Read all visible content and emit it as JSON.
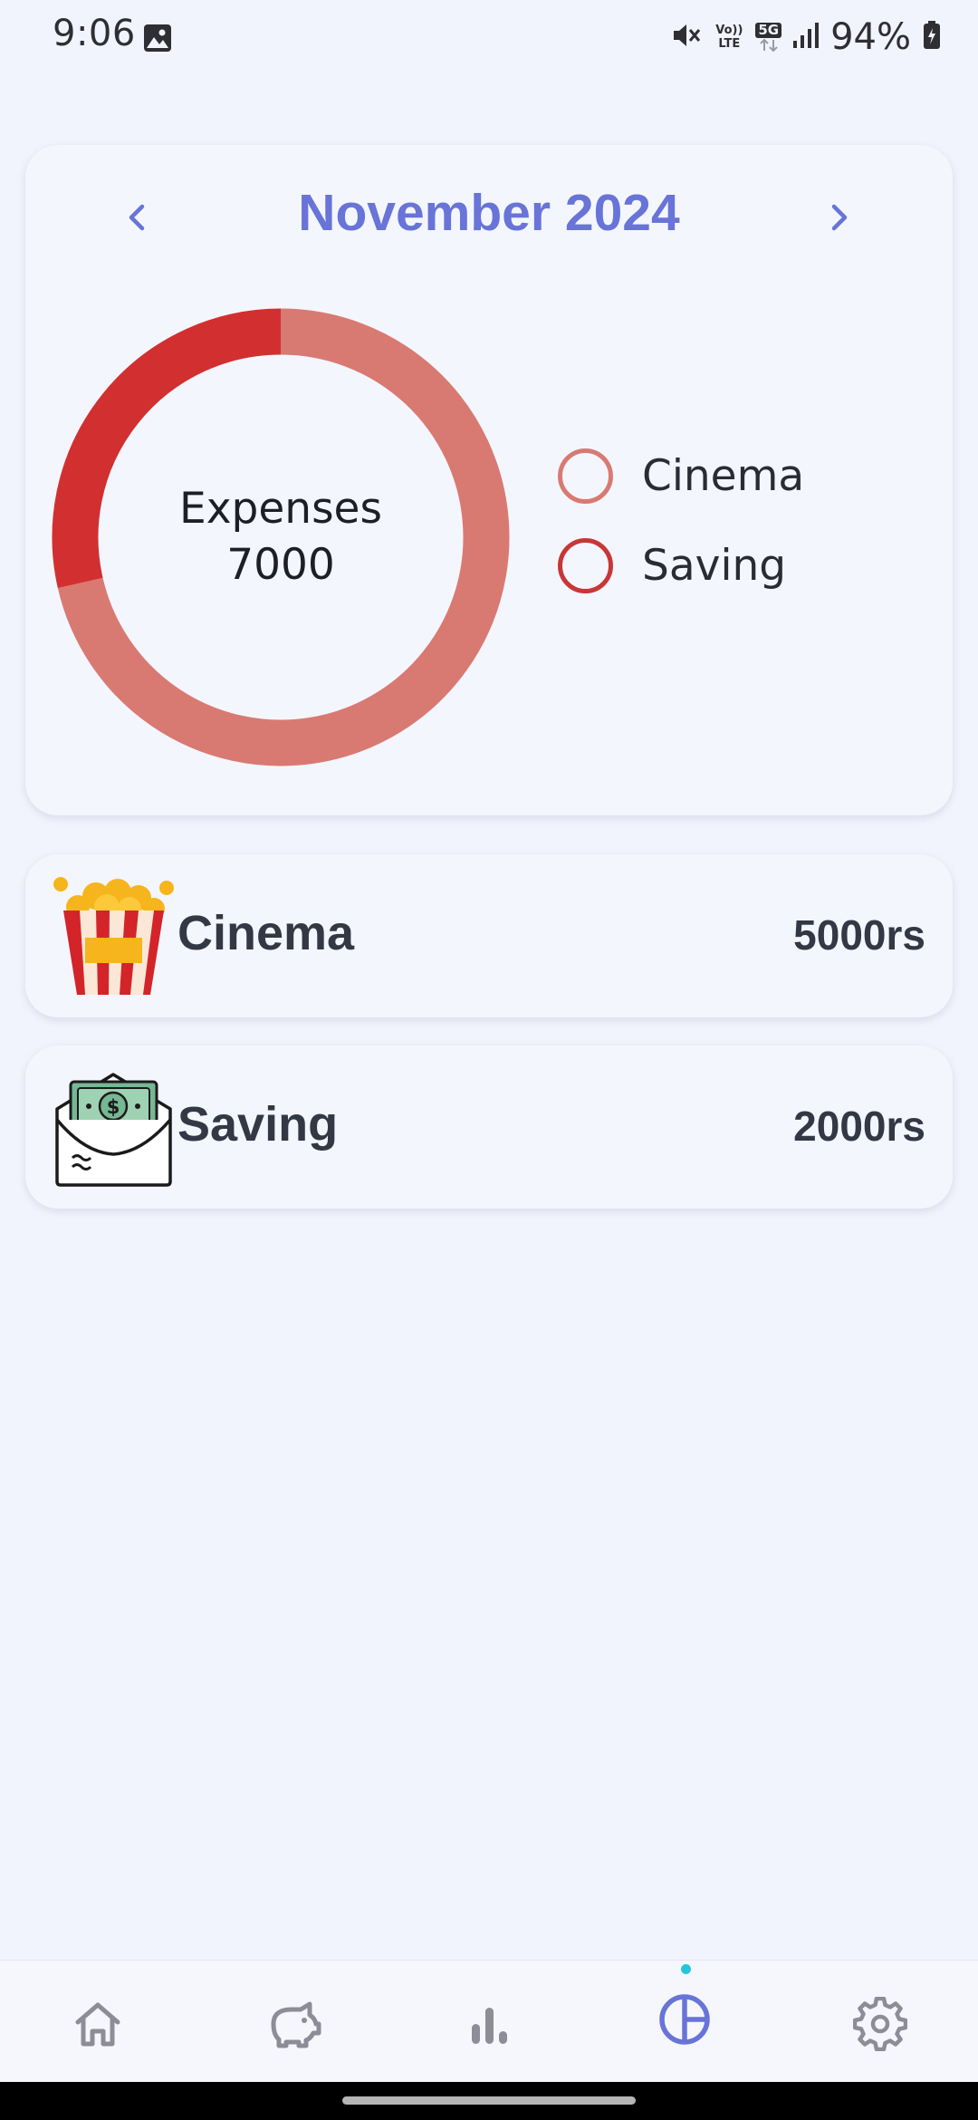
{
  "status_bar": {
    "time": "9:06",
    "battery": "94%",
    "network_volte": "Vo)) LTE",
    "network_5g": "5G"
  },
  "header": {
    "month_title": "November 2024"
  },
  "colors": {
    "accent": "#6874d8",
    "cinema": "#d97a72",
    "saving": "#d23030",
    "background": "#f2f4fd"
  },
  "chart_data": {
    "type": "pie",
    "center_label": "Expenses",
    "center_value": "7000",
    "categories": [
      "Cinema",
      "Saving"
    ],
    "values": [
      5000,
      2000
    ],
    "colors": [
      "#d97a72",
      "#d23030"
    ]
  },
  "legend": [
    {
      "label": "Cinema",
      "color": "#d97a72"
    },
    {
      "label": "Saving",
      "color": "#c83636"
    }
  ],
  "expenses": [
    {
      "label": "Cinema",
      "amount": "5000rs",
      "icon": "popcorn-icon"
    },
    {
      "label": "Saving",
      "amount": "2000rs",
      "icon": "money-envelope-icon"
    }
  ],
  "bottom_nav": [
    {
      "name": "home",
      "icon": "home-icon",
      "active": false
    },
    {
      "name": "savings",
      "icon": "piggy-bank-icon",
      "active": false
    },
    {
      "name": "stats",
      "icon": "bar-chart-icon",
      "active": false
    },
    {
      "name": "analytics",
      "icon": "pie-chart-icon",
      "active": true
    },
    {
      "name": "settings",
      "icon": "gear-icon",
      "active": false
    }
  ]
}
